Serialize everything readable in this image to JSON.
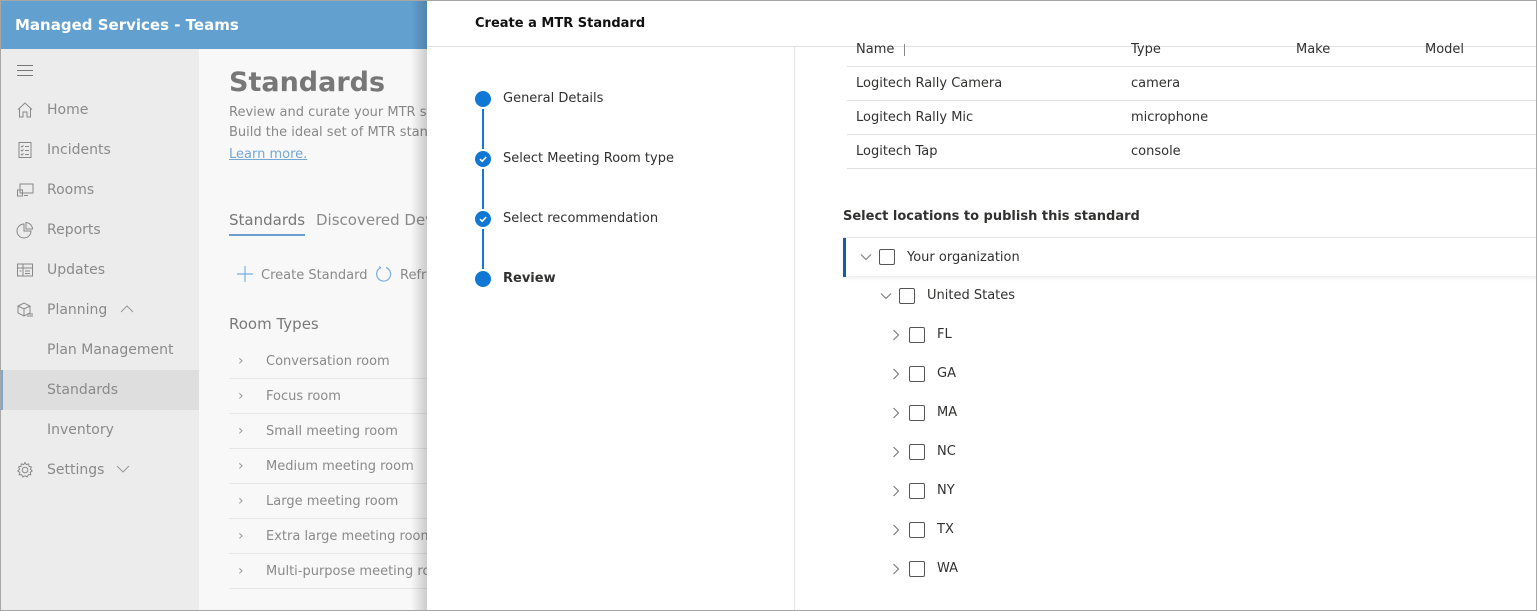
{
  "app": {
    "title": "Managed Services - Teams"
  },
  "sidebar": {
    "menu_icon": "hamburger-icon",
    "items": [
      {
        "label": "Home",
        "icon": "home-icon"
      },
      {
        "label": "Incidents",
        "icon": "checklist-icon"
      },
      {
        "label": "Rooms",
        "icon": "monitor-icon"
      },
      {
        "label": "Reports",
        "icon": "pie-chart-icon"
      },
      {
        "label": "Updates",
        "icon": "updates-icon"
      },
      {
        "label": "Planning",
        "icon": "package-icon",
        "expanded": true
      },
      {
        "label": "Plan Management"
      },
      {
        "label": "Standards",
        "active": true
      },
      {
        "label": "Inventory"
      },
      {
        "label": "Settings",
        "icon": "gear-icon",
        "expanded": false
      }
    ]
  },
  "main": {
    "title": "Standards",
    "description_line1": "Review and curate your MTR sta",
    "description_line2": "Build the ideal set of MTR standa",
    "learn_more": "Learn more.",
    "tabs": [
      {
        "label": "Standards",
        "active": true
      },
      {
        "label": "Discovered Devi"
      }
    ],
    "commands": [
      {
        "label": "Create Standard",
        "icon": "plus-icon"
      },
      {
        "label": "Refre",
        "icon": "refresh-icon"
      }
    ],
    "room_types_heading": "Room Types",
    "room_types": [
      "Conversation room",
      "Focus room",
      "Small meeting room",
      "Medium meeting room",
      "Large meeting room",
      "Extra large meeting room",
      "Multi-purpose meeting ro"
    ]
  },
  "panel": {
    "title": "Create a MTR Standard",
    "steps": [
      {
        "label": "General Details",
        "state": "current"
      },
      {
        "label": "Select Meeting Room type",
        "state": "completed"
      },
      {
        "label": "Select recommendation",
        "state": "completed"
      },
      {
        "label": "Review",
        "state": "active"
      }
    ],
    "device_table": {
      "columns": [
        "Name",
        "Type",
        "Make",
        "Model"
      ],
      "rows": [
        {
          "name": "Logitech Rally Camera",
          "type": "camera",
          "make": "",
          "model": ""
        },
        {
          "name": "Logitech Rally Mic",
          "type": "microphone",
          "make": "",
          "model": ""
        },
        {
          "name": "Logitech Tap",
          "type": "console",
          "make": "",
          "model": ""
        }
      ]
    },
    "locations": {
      "title": "Select locations to publish this standard",
      "root": {
        "label": "Your organization",
        "expanded": true,
        "checked": false
      },
      "country": {
        "label": "United States",
        "expanded": true,
        "checked": false
      },
      "states": [
        {
          "label": "FL",
          "checked": false
        },
        {
          "label": "GA",
          "checked": false
        },
        {
          "label": "MA",
          "checked": false
        },
        {
          "label": "NC",
          "checked": false
        },
        {
          "label": "NY",
          "checked": false
        },
        {
          "label": "TX",
          "checked": false
        },
        {
          "label": "WA",
          "checked": false
        }
      ]
    }
  },
  "colors": {
    "topbar": "#62a0d0",
    "accent": "#0f78d4",
    "tree_selected_bar": "#0f5fa8"
  }
}
